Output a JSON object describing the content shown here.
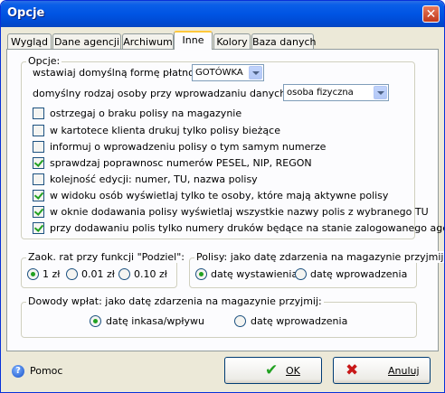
{
  "window": {
    "title": "Opcje",
    "close_glyph": "✕"
  },
  "tabs": [
    {
      "label": "Wygląd"
    },
    {
      "label": "Dane agencji"
    },
    {
      "label": "Archiwum"
    },
    {
      "label": "Inne"
    },
    {
      "label": "Kolory"
    },
    {
      "label": "Baza danych"
    }
  ],
  "active_tab": "Inne",
  "options": {
    "legend": "Opcje:",
    "payment_label": "wstawiaj domyślną formę płatności :",
    "payment_value": "GOTÓWKA",
    "person_label": "domyślny rodzaj osoby przy wprowadzaniu danych klienta:",
    "person_value": "osoba fizyczna",
    "checkboxes": [
      {
        "label": "ostrzegaj o braku polisy na magazynie",
        "checked": false
      },
      {
        "label": "w kartotece klienta drukuj tylko polisy bieżące",
        "checked": false
      },
      {
        "label": "informuj o wprowadzeniu polisy o tym samym numerze",
        "checked": false
      },
      {
        "label": "sprawdzaj poprawnosc numerów PESEL, NIP, REGON",
        "checked": true
      },
      {
        "label": "kolejność edycji: numer, TU, nazwa polisy",
        "checked": false
      },
      {
        "label": "w widoku osób wyświetlaj tylko te osoby, które mają aktywne polisy",
        "checked": true
      },
      {
        "label": "w oknie dodawania polisy wyświetlaj wszystkie nazwy polis z wybranego TU",
        "checked": true
      },
      {
        "label": "przy dodawaniu polis tylko numery druków będące na stanie zalogowanego agenta",
        "checked": true
      }
    ]
  },
  "rounding": {
    "legend": "Zaok. rat przy funkcji \"Podziel\":",
    "choices": [
      {
        "label": "1 zł",
        "checked": true
      },
      {
        "label": "0.01 zł",
        "checked": false
      },
      {
        "label": "0.10 zł",
        "checked": false
      }
    ]
  },
  "policies": {
    "legend": "Polisy: jako datę zdarzenia na magazynie przyjmij:",
    "choices": [
      {
        "label": "datę wystawienia",
        "checked": true
      },
      {
        "label": "datę wprowadzenia",
        "checked": false
      }
    ]
  },
  "payments": {
    "legend": "Dowody wpłat: jako datę zdarzenia na magazynie przyjmij:",
    "choices": [
      {
        "label": "datę inkasa/wpływu",
        "checked": true
      },
      {
        "label": "datę wprowadzenia",
        "checked": false
      }
    ]
  },
  "footer": {
    "help_label": "Pomoc",
    "help_glyph": "?",
    "ok_label": "OK",
    "ok_glyph": "✔",
    "cancel_label": "Anuluj",
    "cancel_glyph": "✖"
  },
  "colors": {
    "ok_icon": "#21a121",
    "cancel_icon": "#c81818",
    "check": "#21a121"
  }
}
